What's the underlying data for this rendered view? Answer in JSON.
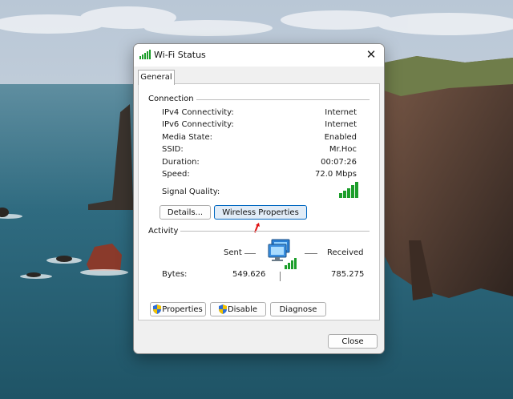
{
  "window": {
    "title": "Wi-Fi Status",
    "close_glyph": "✕"
  },
  "tabs": [
    {
      "label": "General"
    }
  ],
  "connection": {
    "group_label": "Connection",
    "rows": [
      {
        "label": "IPv4 Connectivity:",
        "value": "Internet"
      },
      {
        "label": "IPv6 Connectivity:",
        "value": "Internet"
      },
      {
        "label": "Media State:",
        "value": "Enabled"
      },
      {
        "label": "SSID:",
        "value": "Mr.Hoc"
      },
      {
        "label": "Duration:",
        "value": "00:07:26"
      },
      {
        "label": "Speed:",
        "value": "72.0 Mbps"
      }
    ],
    "signal_label": "Signal Quality:",
    "signal_bars": 5,
    "signal_color": "#1c9e2b"
  },
  "buttons": {
    "details": "Details...",
    "wireless_properties": "Wireless Properties"
  },
  "activity": {
    "group_label": "Activity",
    "sent_label": "Sent",
    "received_label": "Received",
    "bytes_label": "Bytes:",
    "bytes_sent": "549.626",
    "bytes_received": "785.275"
  },
  "actions": {
    "properties": "Properties",
    "disable": "Disable",
    "diagnose": "Diagnose"
  },
  "footer": {
    "close": "Close"
  },
  "colors": {
    "accent": "#0067c0",
    "annotation_arrow": "#e01010"
  }
}
